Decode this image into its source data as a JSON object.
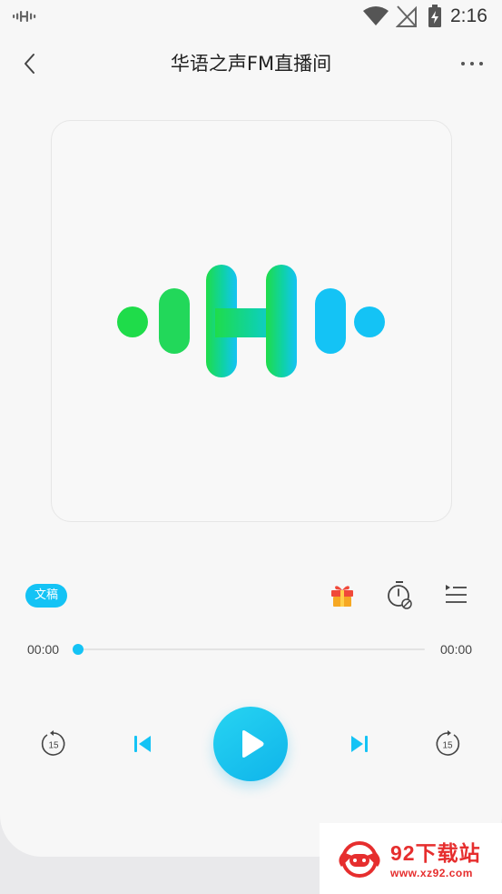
{
  "status_bar": {
    "time": "2:16",
    "app_icon": "ximalaya-waveform-icon",
    "wifi_icon": "wifi-icon",
    "signal_icon": "no-signal-icon",
    "battery_icon": "battery-charging-icon"
  },
  "header": {
    "title": "华语之声FM直播间",
    "back_icon": "chevron-left-icon",
    "more_icon": "more-dots-icon"
  },
  "cover": {
    "logo": "waveform-h-logo",
    "colors": {
      "green": "#1fdc4a",
      "blue": "#14c3f5"
    }
  },
  "actions": {
    "transcript_label": "文稿",
    "gift_icon": "gift-icon",
    "timer_icon": "sleep-timer-icon",
    "playlist_icon": "playlist-icon"
  },
  "progress": {
    "current": "00:00",
    "total": "00:00",
    "fraction": 0.0
  },
  "controls": {
    "rewind_seconds": "15",
    "forward_seconds": "15",
    "prev_icon": "skip-previous-icon",
    "play_icon": "play-icon",
    "next_icon": "skip-next-icon",
    "accent": "#14c3f5"
  },
  "watermark": {
    "title": "92下载站",
    "url": "www.xz92.com",
    "color": "#e62e2e"
  }
}
